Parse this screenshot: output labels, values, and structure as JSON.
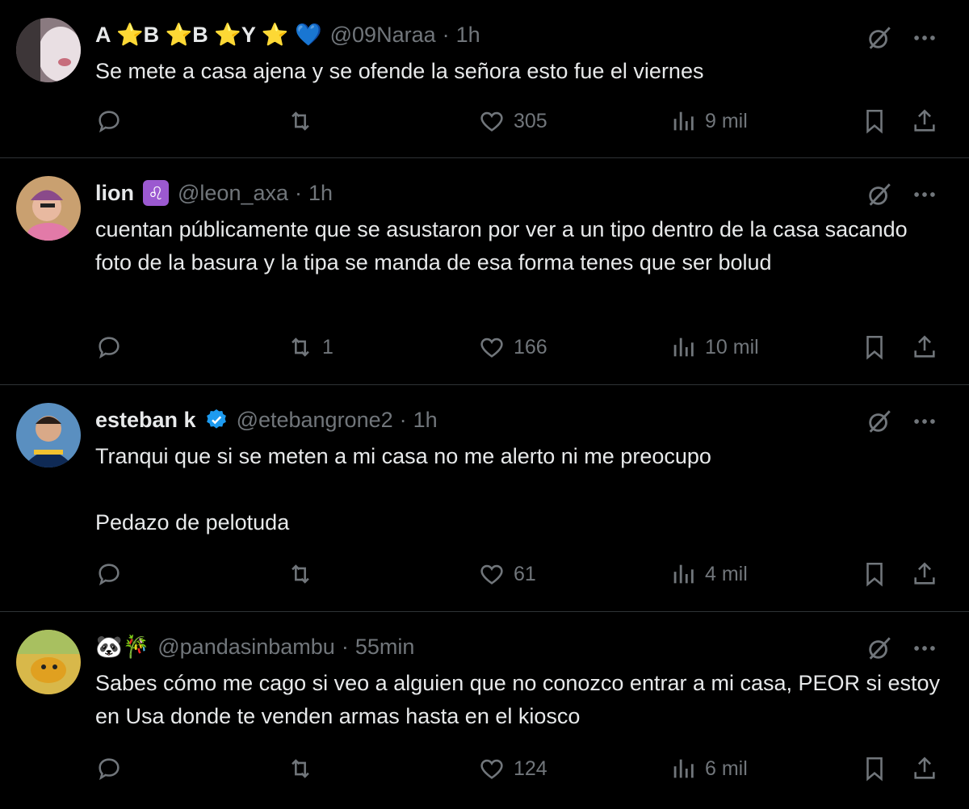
{
  "tweets": [
    {
      "name": "A ⭐B ⭐B ⭐Y ⭐ 💙",
      "handle": "@09Naraa",
      "time": "1h",
      "text": "Se mete a casa ajena y se ofende la señora esto fue el viernes",
      "replies": "",
      "reposts": "",
      "likes": "305",
      "views": "9 mil"
    },
    {
      "name": "lion",
      "badge": "♌",
      "handle": "@leon_axa",
      "time": "1h",
      "text": "cuentan públicamente que se asustaron por ver a un tipo dentro de la casa sacando foto de la basura y la tipa se manda de esa forma tenes que ser bolud",
      "replies": "",
      "reposts": "1",
      "likes": "166",
      "views": "10 mil"
    },
    {
      "name": "esteban k",
      "verified": true,
      "handle": "@etebangrone2",
      "time": "1h",
      "text": "Tranqui que si se meten a mi casa no me alerto ni me preocupo\n\nPedazo de pelotuda",
      "replies": "",
      "reposts": "",
      "likes": "61",
      "views": "4 mil"
    },
    {
      "name": "🐼🎋",
      "handle": "@pandasinbambu",
      "time": "55min",
      "text": "Sabes cómo me cago si veo a alguien que no conozco entrar a mi casa, PEOR si estoy en Usa donde te venden armas hasta en el kiosco",
      "replies": "",
      "reposts": "",
      "likes": "124",
      "views": "6 mil"
    }
  ],
  "icons": {
    "reply": "reply-icon",
    "repost": "repost-icon",
    "like": "heart-icon",
    "views": "views-icon",
    "bookmark": "bookmark-icon",
    "share": "share-icon",
    "grok": "grok-icon",
    "more": "more-icon"
  },
  "colors": {
    "background": "#000000",
    "text": "#e7e9ea",
    "muted": "#71767b",
    "divider": "#2f3336",
    "verified": "#1d9bf0"
  }
}
